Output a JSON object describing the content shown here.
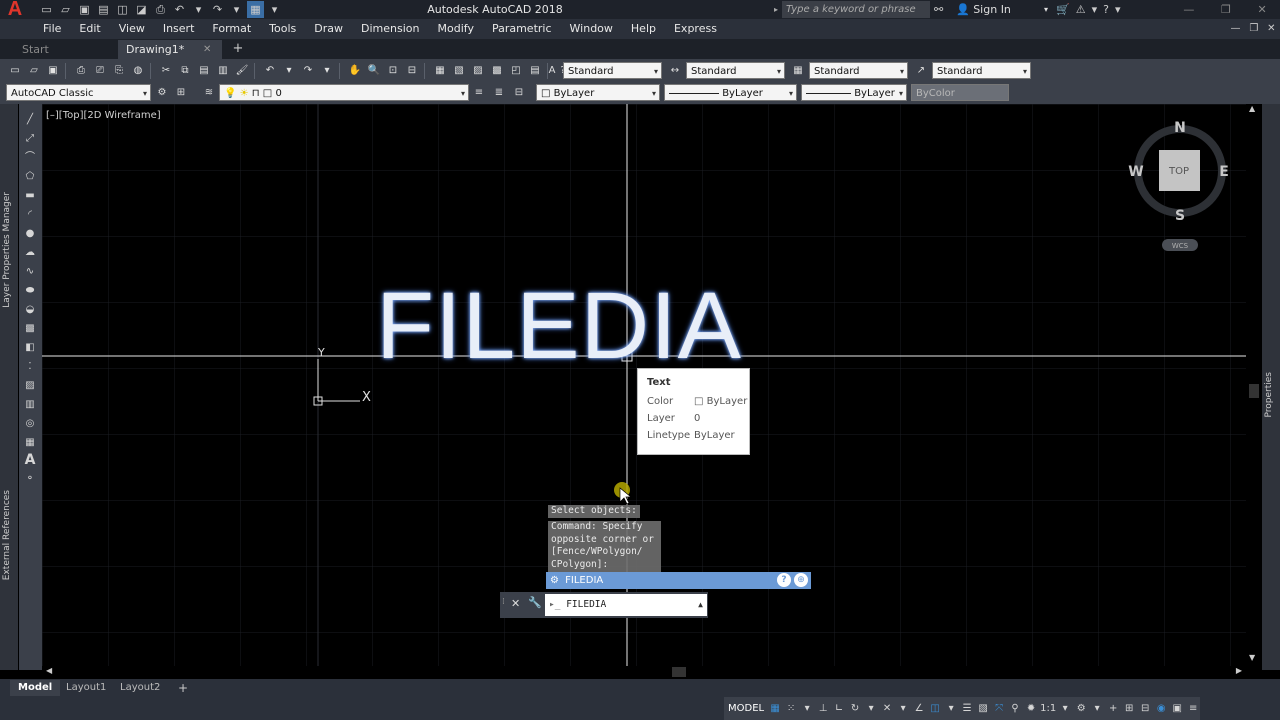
{
  "app": {
    "title": "Autodesk AutoCAD 2018",
    "logo_letter": "A",
    "search_placeholder": "Type a keyword or phrase",
    "sign_in": "Sign In"
  },
  "menu": [
    "File",
    "Edit",
    "View",
    "Insert",
    "Format",
    "Tools",
    "Draw",
    "Dimension",
    "Modify",
    "Parametric",
    "Window",
    "Help",
    "Express"
  ],
  "file_tabs": {
    "start": "Start",
    "drawing": "Drawing1*"
  },
  "toolbar": {
    "text_style": "Standard",
    "dim_style": "Standard",
    "table_style": "Standard",
    "mleader_style": "Standard",
    "workspace": "AutoCAD Classic",
    "layer": "0",
    "color": "ByLayer",
    "linetype": "ByLayer",
    "lineweight": "ByLayer",
    "plotstyle": "ByColor"
  },
  "side_palettes": {
    "layer_manager": "Layer Properties Manager",
    "external_refs": "External References",
    "properties": "Properties"
  },
  "viewport": {
    "label": "[–][Top][2D Wireframe]",
    "drawn_text": "FILEDIA",
    "ucs_y": "Y",
    "ucs_x": "X"
  },
  "viewcube": {
    "north": "N",
    "south": "S",
    "east": "E",
    "west": "W",
    "face": "TOP",
    "wcs": "WCS"
  },
  "tooltip": {
    "title": "Text",
    "color_label": "Color",
    "color_value": "ByLayer",
    "layer_label": "Layer",
    "layer_value": "0",
    "linetype_label": "Linetype",
    "linetype_value": "ByLayer"
  },
  "command": {
    "history1": "Select objects:",
    "history2": [
      "Command: Specify",
      "opposite corner or",
      "[Fence/WPolygon/",
      "CPolygon]:"
    ],
    "suggestion": "FILEDIA",
    "input": "FILEDIA"
  },
  "layout_tabs": [
    "Model",
    "Layout1",
    "Layout2"
  ],
  "status": {
    "model": "MODEL",
    "scale": "1:1"
  },
  "colors": {
    "accent": "#6b9ad6",
    "background": "#000000",
    "chrome": "#3b404a"
  }
}
